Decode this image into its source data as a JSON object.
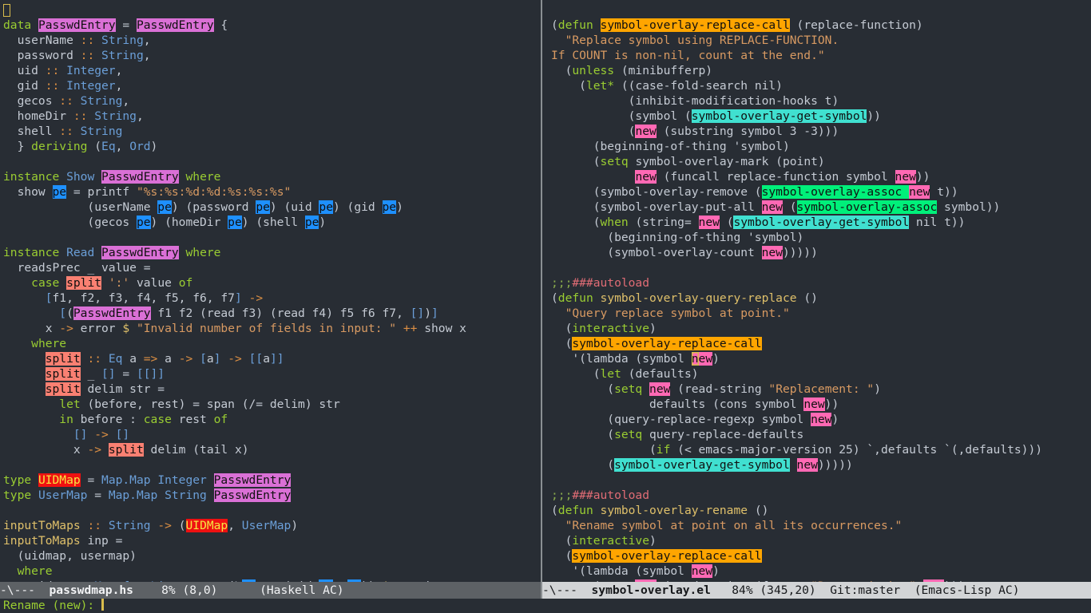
{
  "colors": {
    "bg": "#282d34",
    "fg": "#c5cbd4",
    "kw": "#9acd32",
    "ty": "#6b9fd8",
    "st": "#d89a62",
    "op": "#dd9044",
    "fn": "#dfc06a",
    "cr": "#e06c75",
    "cg": "#8aab4c",
    "h_orchid": "#da70d6",
    "h_blue": "#1e90ff",
    "h_salmon": "#fa8072",
    "h_red": "#ee1111",
    "h_red_fg": "#f5e642",
    "h_orange": "#ffa500",
    "h_cyan": "#40e0d0",
    "h_pink": "#ff69b4",
    "h_green": "#00f07a",
    "cursor": "#d9bc4c",
    "ml_inactive_bg": "#5d6165",
    "ml_inactive_fg": "#f2f3f5",
    "ml_active_bg": "#d2d4d6",
    "ml_active_fg": "#16181b",
    "divider": "#8b9093"
  },
  "modeline_left": {
    "prefix": "-\\---  ",
    "filename": "passwdmap.hs",
    "rest": "    8% (8,0)      (Haskell AC)"
  },
  "modeline_right": {
    "prefix": "-\\---  ",
    "filename": "symbol-overlay.el",
    "rest": "   84% (345,20)  Git:master  (Emacs-Lisp AC)"
  },
  "minibuffer": {
    "prompt": "Rename (new): "
  },
  "left_lines": [
    [
      [
        "cub",
        " "
      ]
    ],
    [
      [
        "k",
        "data"
      ],
      [
        "d",
        " "
      ],
      [
        "P",
        "PasswdEntry"
      ],
      [
        "d",
        " = "
      ],
      [
        "P",
        "PasswdEntry"
      ],
      [
        "d",
        " {"
      ]
    ],
    [
      [
        "d",
        "  userName "
      ],
      [
        "o",
        "::"
      ],
      [
        "d",
        " "
      ],
      [
        "t",
        "String"
      ],
      [
        "d",
        ","
      ]
    ],
    [
      [
        "d",
        "  password "
      ],
      [
        "o",
        "::"
      ],
      [
        "d",
        " "
      ],
      [
        "t",
        "String"
      ],
      [
        "d",
        ","
      ]
    ],
    [
      [
        "d",
        "  uid "
      ],
      [
        "o",
        "::"
      ],
      [
        "d",
        " "
      ],
      [
        "t",
        "Integer"
      ],
      [
        "d",
        ","
      ]
    ],
    [
      [
        "d",
        "  gid "
      ],
      [
        "o",
        "::"
      ],
      [
        "d",
        " "
      ],
      [
        "t",
        "Integer"
      ],
      [
        "d",
        ","
      ]
    ],
    [
      [
        "d",
        "  gecos "
      ],
      [
        "o",
        "::"
      ],
      [
        "d",
        " "
      ],
      [
        "t",
        "String"
      ],
      [
        "d",
        ","
      ]
    ],
    [
      [
        "d",
        "  homeDir "
      ],
      [
        "o",
        "::"
      ],
      [
        "d",
        " "
      ],
      [
        "t",
        "String"
      ],
      [
        "d",
        ","
      ]
    ],
    [
      [
        "d",
        "  shell "
      ],
      [
        "o",
        "::"
      ],
      [
        "d",
        " "
      ],
      [
        "t",
        "String"
      ]
    ],
    [
      [
        "d",
        "  } "
      ],
      [
        "k",
        "deriving"
      ],
      [
        "d",
        " ("
      ],
      [
        "t",
        "Eq"
      ],
      [
        "d",
        ", "
      ],
      [
        "t",
        "Ord"
      ],
      [
        "d",
        ")"
      ]
    ],
    [
      [
        "d",
        ""
      ]
    ],
    [
      [
        "k",
        "instance"
      ],
      [
        "d",
        " "
      ],
      [
        "t",
        "Show"
      ],
      [
        "d",
        " "
      ],
      [
        "P",
        "PasswdEntry"
      ],
      [
        "d",
        " "
      ],
      [
        "k",
        "where"
      ]
    ],
    [
      [
        "d",
        "  show "
      ],
      [
        "B",
        "pe"
      ],
      [
        "d",
        " = printf "
      ],
      [
        "s",
        "\"%s:%s:%d:%d:%s:%s:%s\""
      ]
    ],
    [
      [
        "d",
        "            (userName "
      ],
      [
        "B",
        "pe"
      ],
      [
        "d",
        ") (password "
      ],
      [
        "B",
        "pe"
      ],
      [
        "d",
        ") (uid "
      ],
      [
        "B",
        "pe"
      ],
      [
        "d",
        ") (gid "
      ],
      [
        "B",
        "pe"
      ],
      [
        "d",
        ")"
      ]
    ],
    [
      [
        "d",
        "            (gecos "
      ],
      [
        "B",
        "pe"
      ],
      [
        "d",
        ") (homeDir "
      ],
      [
        "B",
        "pe"
      ],
      [
        "d",
        ") (shell "
      ],
      [
        "B",
        "pe"
      ],
      [
        "d",
        ")"
      ]
    ],
    [
      [
        "d",
        ""
      ]
    ],
    [
      [
        "k",
        "instance"
      ],
      [
        "d",
        " "
      ],
      [
        "t",
        "Read"
      ],
      [
        "d",
        " "
      ],
      [
        "P",
        "PasswdEntry"
      ],
      [
        "d",
        " "
      ],
      [
        "k",
        "where"
      ]
    ],
    [
      [
        "d",
        "  readsPrec _ value ="
      ]
    ],
    [
      [
        "d",
        "    "
      ],
      [
        "k",
        "case"
      ],
      [
        "d",
        " "
      ],
      [
        "S",
        "split"
      ],
      [
        "d",
        " "
      ],
      [
        "s",
        "':'"
      ],
      [
        "d",
        " value "
      ],
      [
        "k",
        "of"
      ]
    ],
    [
      [
        "d",
        "      "
      ],
      [
        "t",
        "["
      ],
      [
        "d",
        "f1, f2, f3, f4, f5, f6, f7"
      ],
      [
        "t",
        "]"
      ],
      [
        "d",
        " "
      ],
      [
        "o",
        "->"
      ]
    ],
    [
      [
        "d",
        "        "
      ],
      [
        "t",
        "["
      ],
      [
        "d",
        "("
      ],
      [
        "P",
        "PasswdEntry"
      ],
      [
        "d",
        " f1 f2 (read f3) (read f4) f5 f6 f7, "
      ],
      [
        "t",
        "[]"
      ],
      [
        "d",
        ")"
      ],
      [
        "t",
        "]"
      ]
    ],
    [
      [
        "d",
        "      x "
      ],
      [
        "o",
        "->"
      ],
      [
        "d",
        " error "
      ],
      [
        "f",
        "$"
      ],
      [
        "d",
        " "
      ],
      [
        "s",
        "\"Invalid number of fields in input: \""
      ],
      [
        "d",
        " "
      ],
      [
        "o",
        "++"
      ],
      [
        "d",
        " show x"
      ]
    ],
    [
      [
        "d",
        "    "
      ],
      [
        "k",
        "where"
      ]
    ],
    [
      [
        "d",
        "      "
      ],
      [
        "S",
        "split"
      ],
      [
        "d",
        " "
      ],
      [
        "o",
        "::"
      ],
      [
        "d",
        " "
      ],
      [
        "t",
        "Eq"
      ],
      [
        "d",
        " a "
      ],
      [
        "o",
        "=>"
      ],
      [
        "d",
        " a "
      ],
      [
        "o",
        "->"
      ],
      [
        "d",
        " "
      ],
      [
        "t",
        "["
      ],
      [
        "d",
        "a"
      ],
      [
        "t",
        "]"
      ],
      [
        "d",
        " "
      ],
      [
        "o",
        "->"
      ],
      [
        "d",
        " "
      ],
      [
        "t",
        "[["
      ],
      [
        "d",
        "a"
      ],
      [
        "t",
        "]]"
      ]
    ],
    [
      [
        "d",
        "      "
      ],
      [
        "S",
        "split"
      ],
      [
        "d",
        " _ "
      ],
      [
        "t",
        "[]"
      ],
      [
        "d",
        " = "
      ],
      [
        "t",
        "[[]]"
      ]
    ],
    [
      [
        "d",
        "      "
      ],
      [
        "S",
        "split"
      ],
      [
        "d",
        " delim str ="
      ]
    ],
    [
      [
        "d",
        "        "
      ],
      [
        "k",
        "let"
      ],
      [
        "d",
        " (before, rest) = span (/= delim) str"
      ]
    ],
    [
      [
        "d",
        "        "
      ],
      [
        "k",
        "in"
      ],
      [
        "d",
        " before : "
      ],
      [
        "k",
        "case"
      ],
      [
        "d",
        " rest "
      ],
      [
        "k",
        "of"
      ]
    ],
    [
      [
        "d",
        "          "
      ],
      [
        "t",
        "[]"
      ],
      [
        "d",
        " "
      ],
      [
        "o",
        "->"
      ],
      [
        "d",
        " "
      ],
      [
        "t",
        "[]"
      ]
    ],
    [
      [
        "d",
        "          x "
      ],
      [
        "o",
        "->"
      ],
      [
        "d",
        " "
      ],
      [
        "S",
        "split"
      ],
      [
        "d",
        " delim (tail x)"
      ]
    ],
    [
      [
        "d",
        ""
      ]
    ],
    [
      [
        "k",
        "type"
      ],
      [
        "d",
        " "
      ],
      [
        "R",
        "UIDMap"
      ],
      [
        "d",
        " = "
      ],
      [
        "t",
        "Map.Map Integer"
      ],
      [
        "d",
        " "
      ],
      [
        "P",
        "PasswdEntry"
      ]
    ],
    [
      [
        "k",
        "type"
      ],
      [
        "d",
        " "
      ],
      [
        "t",
        "UserMap"
      ],
      [
        "d",
        " = "
      ],
      [
        "t",
        "Map.Map String"
      ],
      [
        "d",
        " "
      ],
      [
        "P",
        "PasswdEntry"
      ]
    ],
    [
      [
        "d",
        ""
      ]
    ],
    [
      [
        "f",
        "inputToMaps"
      ],
      [
        "d",
        " "
      ],
      [
        "o",
        "::"
      ],
      [
        "d",
        " "
      ],
      [
        "t",
        "String"
      ],
      [
        "d",
        " "
      ],
      [
        "o",
        "->"
      ],
      [
        "d",
        " ("
      ],
      [
        "R",
        "UIDMap"
      ],
      [
        "d",
        ", "
      ],
      [
        "t",
        "UserMap"
      ],
      [
        "d",
        ")"
      ]
    ],
    [
      [
        "f",
        "inputToMaps"
      ],
      [
        "d",
        " inp ="
      ]
    ],
    [
      [
        "d",
        "  (uidmap, usermap)"
      ]
    ],
    [
      [
        "d",
        "  "
      ],
      [
        "k",
        "where"
      ]
    ],
    [
      [
        "d",
        "    uidmap = "
      ],
      [
        "t",
        "Map.fromList"
      ],
      [
        "d",
        " . map (\\"
      ],
      [
        "B",
        "pe"
      ],
      [
        "d",
        " "
      ],
      [
        "o",
        "->"
      ],
      [
        "d",
        " (uid "
      ],
      [
        "B",
        "pe"
      ],
      [
        "d",
        ", "
      ],
      [
        "B",
        "pe"
      ],
      [
        "d",
        ")) "
      ],
      [
        "f",
        "$"
      ],
      [
        "d",
        " entries"
      ]
    ]
  ],
  "right_lines": [
    [
      [
        "d",
        ""
      ]
    ],
    [
      [
        "d",
        "("
      ],
      [
        "k",
        "defun"
      ],
      [
        "d",
        " "
      ],
      [
        "O",
        "symbol-overlay-replace-call"
      ],
      [
        "d",
        " (replace-function)"
      ]
    ],
    [
      [
        "s",
        "  \"Replace symbol using REPLACE-FUNCTION."
      ]
    ],
    [
      [
        "s",
        "If COUNT is non-nil, count at the end.\""
      ]
    ],
    [
      [
        "d",
        "  ("
      ],
      [
        "k",
        "unless"
      ],
      [
        "d",
        " (minibufferp)"
      ]
    ],
    [
      [
        "d",
        "    ("
      ],
      [
        "k",
        "let*"
      ],
      [
        "d",
        " ((case-fold-search nil)"
      ]
    ],
    [
      [
        "d",
        "           (inhibit-modification-hooks t)"
      ]
    ],
    [
      [
        "d",
        "           (symbol ("
      ],
      [
        "C",
        "symbol-overlay-get-symbol"
      ],
      [
        "d",
        "))"
      ]
    ],
    [
      [
        "d",
        "           ("
      ],
      [
        "K",
        "new"
      ],
      [
        "d",
        " (substring symbol 3 -3)))"
      ]
    ],
    [
      [
        "d",
        "      (beginning-of-thing 'symbol)"
      ]
    ],
    [
      [
        "d",
        "      ("
      ],
      [
        "k",
        "setq"
      ],
      [
        "d",
        " symbol-overlay-mark (point)"
      ]
    ],
    [
      [
        "d",
        "            "
      ],
      [
        "K",
        "new"
      ],
      [
        "d",
        " (funcall replace-function symbol "
      ],
      [
        "K",
        "new"
      ],
      [
        "d",
        "))"
      ]
    ],
    [
      [
        "d",
        "      (symbol-overlay-remove ("
      ],
      [
        "G",
        "symbol-overlay-assoc "
      ],
      [
        "K",
        "new"
      ],
      [
        "d",
        " t))"
      ]
    ],
    [
      [
        "d",
        "      (symbol-overlay-put-all "
      ],
      [
        "K",
        "new"
      ],
      [
        "d",
        " ("
      ],
      [
        "G",
        "symbol-overlay-assoc"
      ],
      [
        "d",
        " symbol))"
      ]
    ],
    [
      [
        "d",
        "      ("
      ],
      [
        "k",
        "when"
      ],
      [
        "d",
        " (string= "
      ],
      [
        "K",
        "new"
      ],
      [
        "d",
        " ("
      ],
      [
        "C",
        "symbol-overlay-get-symbol"
      ],
      [
        "d",
        " nil t))"
      ]
    ],
    [
      [
        "d",
        "        (beginning-of-thing 'symbol)"
      ]
    ],
    [
      [
        "d",
        "        (symbol-overlay-count "
      ],
      [
        "K",
        "new"
      ],
      [
        "d",
        ")))))"
      ]
    ],
    [
      [
        "d",
        ""
      ]
    ],
    [
      [
        "cg",
        ";;;"
      ],
      [
        "cr",
        "###autoload"
      ]
    ],
    [
      [
        "d",
        "("
      ],
      [
        "k",
        "defun"
      ],
      [
        "d",
        " "
      ],
      [
        "f",
        "symbol-overlay-query-replace"
      ],
      [
        "d",
        " ()"
      ]
    ],
    [
      [
        "s",
        "  \"Query replace symbol at point.\""
      ]
    ],
    [
      [
        "d",
        "  ("
      ],
      [
        "k",
        "interactive"
      ],
      [
        "d",
        ")"
      ]
    ],
    [
      [
        "d",
        "  ("
      ],
      [
        "O",
        "symbol-overlay-replace-call"
      ]
    ],
    [
      [
        "d",
        "   '(lambda (symbol "
      ],
      [
        "KC",
        "n"
      ],
      [
        "K",
        "ew"
      ],
      [
        "d",
        ")"
      ]
    ],
    [
      [
        "d",
        "      ("
      ],
      [
        "k",
        "let"
      ],
      [
        "d",
        " (defaults)"
      ]
    ],
    [
      [
        "d",
        "        ("
      ],
      [
        "k",
        "setq"
      ],
      [
        "d",
        " "
      ],
      [
        "K",
        "new"
      ],
      [
        "d",
        " (read-string "
      ],
      [
        "s",
        "\"Replacement: \""
      ],
      [
        "d",
        ")"
      ]
    ],
    [
      [
        "d",
        "              defaults (cons symbol "
      ],
      [
        "K",
        "new"
      ],
      [
        "d",
        "))"
      ]
    ],
    [
      [
        "d",
        "        (query-replace-regexp symbol "
      ],
      [
        "K",
        "new"
      ],
      [
        "d",
        ")"
      ]
    ],
    [
      [
        "d",
        "        ("
      ],
      [
        "k",
        "setq"
      ],
      [
        "d",
        " query-replace-defaults"
      ]
    ],
    [
      [
        "d",
        "              ("
      ],
      [
        "k",
        "if"
      ],
      [
        "d",
        " (< emacs-major-version 25) `,defaults `(,defaults)))"
      ]
    ],
    [
      [
        "d",
        "        ("
      ],
      [
        "C",
        "symbol-overlay-get-symbol"
      ],
      [
        "d",
        " "
      ],
      [
        "K",
        "new"
      ],
      [
        "d",
        ")))))"
      ]
    ],
    [
      [
        "d",
        ""
      ]
    ],
    [
      [
        "cg",
        ";;;"
      ],
      [
        "cr",
        "###autoload"
      ]
    ],
    [
      [
        "d",
        "("
      ],
      [
        "k",
        "defun"
      ],
      [
        "d",
        " "
      ],
      [
        "f",
        "symbol-overlay-rename"
      ],
      [
        "d",
        " ()"
      ]
    ],
    [
      [
        "s",
        "  \"Rename symbol at point on all its occurrences.\""
      ]
    ],
    [
      [
        "d",
        "  ("
      ],
      [
        "k",
        "interactive"
      ],
      [
        "d",
        ")"
      ]
    ],
    [
      [
        "d",
        "  ("
      ],
      [
        "O",
        "symbol-overlay-replace-call"
      ]
    ],
    [
      [
        "d",
        "   '(lambda (symbol "
      ],
      [
        "K",
        "new"
      ],
      [
        "d",
        ")"
      ]
    ],
    [
      [
        "d",
        "      ("
      ],
      [
        "k",
        "setq"
      ],
      [
        "d",
        " "
      ],
      [
        "K",
        "new"
      ],
      [
        "d",
        " (read-string (format "
      ],
      [
        "s",
        "\"Rename (%s): \""
      ],
      [
        "d",
        " "
      ],
      [
        "K",
        "new"
      ],
      [
        "d",
        ")))"
      ]
    ]
  ]
}
